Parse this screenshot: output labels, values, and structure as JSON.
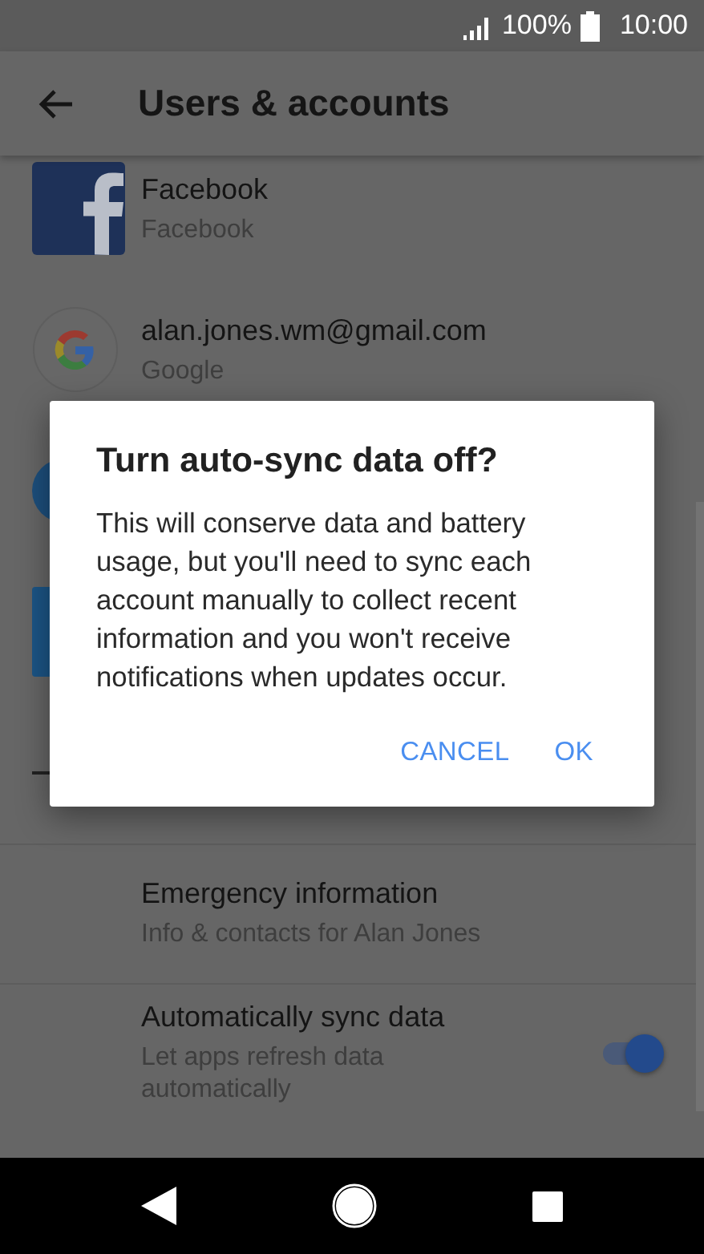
{
  "status_bar": {
    "battery": "100%",
    "time": "10:00"
  },
  "app_bar": {
    "title": "Users & accounts"
  },
  "accounts": [
    {
      "kind": "facebook",
      "name": "Facebook",
      "type": "Facebook"
    },
    {
      "kind": "google",
      "name": "alan.jones.wm@gmail.com",
      "type": "Google"
    },
    {
      "kind": "circle"
    },
    {
      "kind": "square"
    },
    {
      "kind": "dash"
    }
  ],
  "settings": [
    {
      "kind": "text",
      "title": "Emergency information",
      "summary": "Info & contacts for Alan Jones"
    },
    {
      "kind": "switch",
      "title": "Automatically sync data",
      "summary": "Let apps refresh data automatically",
      "checked": true
    }
  ],
  "dialog": {
    "title": "Turn auto-sync data off?",
    "message": "This will conserve data and battery usage, but you'll need to sync each account manually to collect recent information and you won't receive notifications when updates occur.",
    "buttons": [
      "CANCEL",
      "OK"
    ]
  }
}
